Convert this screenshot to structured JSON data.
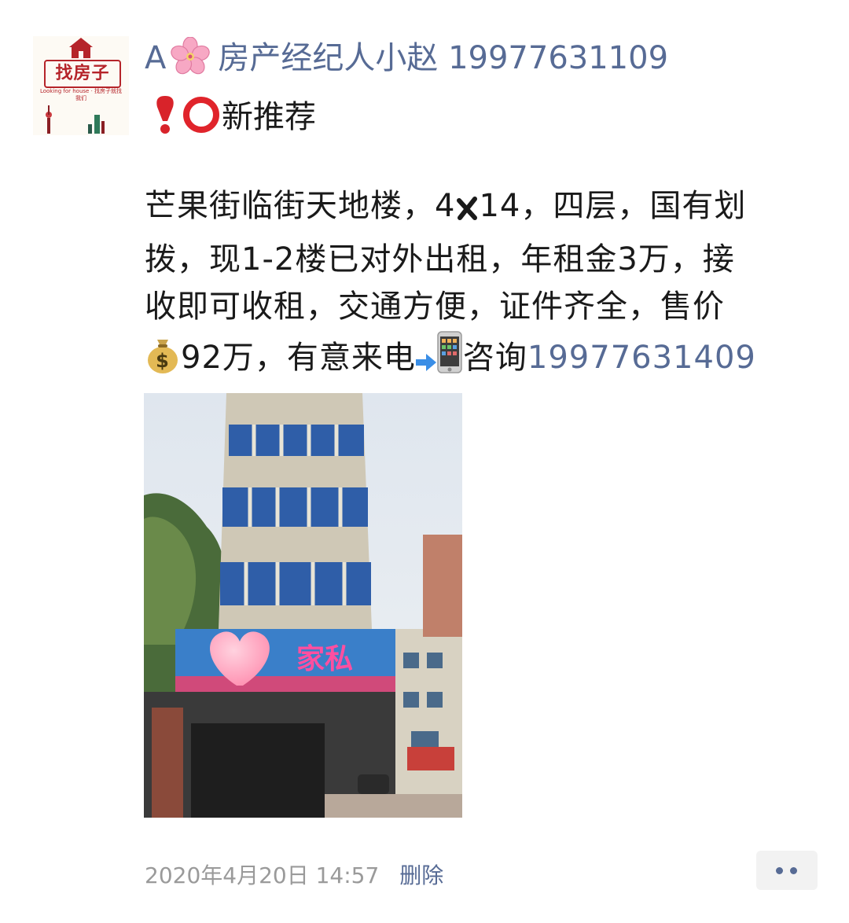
{
  "post": {
    "avatar_label": "找房子",
    "avatar_sub": "Looking for house · 找房子就找我们",
    "author_prefix": "A",
    "author_name": "房产经纪人小赵 19977631109",
    "tag_text": "新推荐",
    "body_lines": [
      "芒果街临街天地楼，4",
      "14，四层，国有划",
      "拨，现1-2楼已对外出租，年租金3万，接",
      "收即可收租，交通方便，证件齐全，售价",
      "92万，有意来电",
      "咨询",
      "19977631409"
    ],
    "photo_sign": "家私",
    "timestamp": "2020年4月20日 14:57",
    "delete_label": "删除"
  },
  "icons": {
    "flower": "cherry-blossom-icon",
    "exclamation": "heavy-exclamation-icon",
    "circle": "hollow-red-circle-icon",
    "multiply": "multiply-x-icon",
    "money": "money-bag-icon",
    "arrow": "right-arrow-icon",
    "phone": "mobile-phone-icon",
    "more": "more-dots-icon"
  },
  "colors": {
    "link": "#576b95",
    "text": "#1a1a1a",
    "meta": "#9a9a9a",
    "brand_red": "#b5242a"
  }
}
